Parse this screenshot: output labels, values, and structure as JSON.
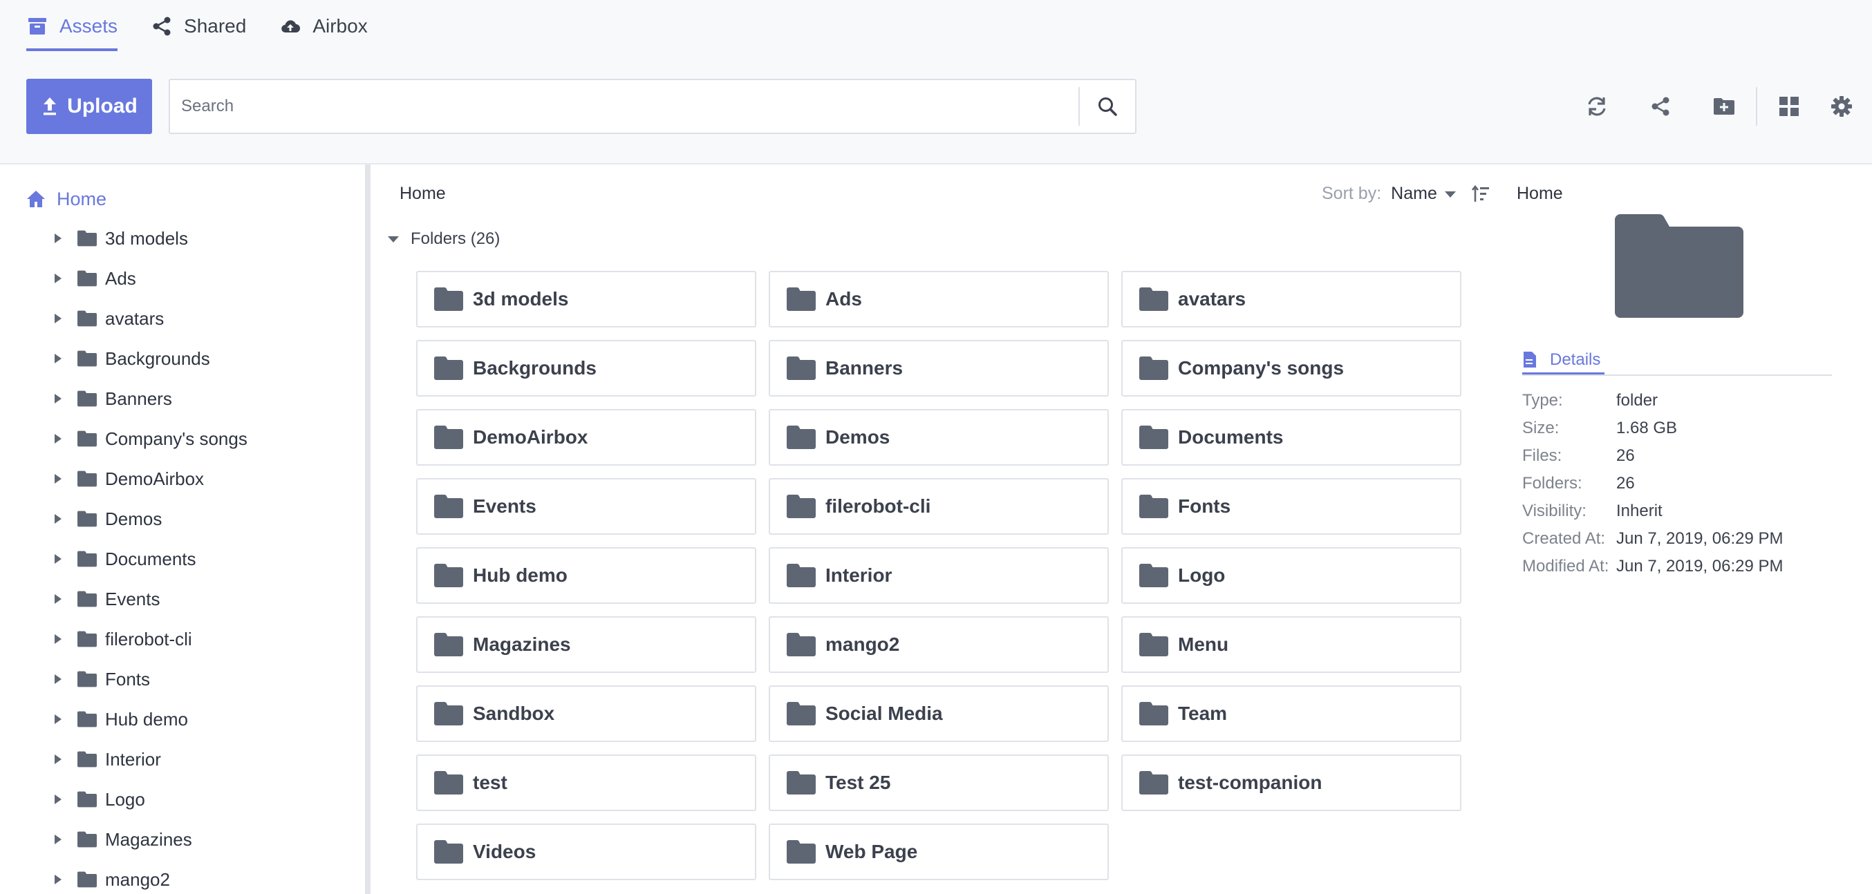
{
  "nav": {
    "tabs": [
      {
        "label": "Assets",
        "icon": "archive-icon",
        "active": true
      },
      {
        "label": "Shared",
        "icon": "share-icon",
        "active": false
      },
      {
        "label": "Airbox",
        "icon": "cloud-upload-icon",
        "active": false
      }
    ]
  },
  "toolbar": {
    "upload_label": "Upload",
    "search_placeholder": "Search",
    "tools": [
      "refresh-icon",
      "share-icon",
      "new-folder-icon",
      "grid-view-icon",
      "gear-icon"
    ]
  },
  "sidebar": {
    "home_label": "Home",
    "items": [
      {
        "label": "3d models"
      },
      {
        "label": "Ads"
      },
      {
        "label": "avatars"
      },
      {
        "label": "Backgrounds"
      },
      {
        "label": "Banners"
      },
      {
        "label": "Company's songs"
      },
      {
        "label": "DemoAirbox"
      },
      {
        "label": "Demos"
      },
      {
        "label": "Documents"
      },
      {
        "label": "Events"
      },
      {
        "label": "filerobot-cli"
      },
      {
        "label": "Fonts"
      },
      {
        "label": "Hub demo"
      },
      {
        "label": "Interior"
      },
      {
        "label": "Logo"
      },
      {
        "label": "Magazines"
      },
      {
        "label": "mango2"
      }
    ]
  },
  "main": {
    "breadcrumb": "Home",
    "sort_label": "Sort by:",
    "sort_value": "Name",
    "folders_header": "Folders (26)",
    "folders": [
      {
        "name": "3d models"
      },
      {
        "name": "Ads"
      },
      {
        "name": "avatars"
      },
      {
        "name": "Backgrounds"
      },
      {
        "name": "Banners"
      },
      {
        "name": "Company's songs"
      },
      {
        "name": "DemoAirbox"
      },
      {
        "name": "Demos"
      },
      {
        "name": "Documents"
      },
      {
        "name": "Events"
      },
      {
        "name": "filerobot-cli"
      },
      {
        "name": "Fonts"
      },
      {
        "name": "Hub demo"
      },
      {
        "name": "Interior"
      },
      {
        "name": "Logo"
      },
      {
        "name": "Magazines"
      },
      {
        "name": "mango2"
      },
      {
        "name": "Menu"
      },
      {
        "name": "Sandbox"
      },
      {
        "name": "Social Media"
      },
      {
        "name": "Team"
      },
      {
        "name": "test"
      },
      {
        "name": "Test 25"
      },
      {
        "name": "test-companion"
      },
      {
        "name": "Videos"
      },
      {
        "name": "Web Page"
      }
    ]
  },
  "details": {
    "breadcrumb": "Home",
    "tab_label": "Details",
    "props": [
      {
        "key": "Type:",
        "value": "folder"
      },
      {
        "key": "Size:",
        "value": "1.68 GB"
      },
      {
        "key": "Files:",
        "value": "26"
      },
      {
        "key": "Folders:",
        "value": "26"
      },
      {
        "key": "Visibility:",
        "value": "Inherit"
      },
      {
        "key": "Created At:",
        "value": "Jun 7, 2019, 06:29 PM"
      },
      {
        "key": "Modified At:",
        "value": "Jun 7, 2019, 06:29 PM"
      }
    ]
  },
  "colors": {
    "accent": "#6878de",
    "folder": "#5f6673",
    "border": "#dfe2e8"
  }
}
